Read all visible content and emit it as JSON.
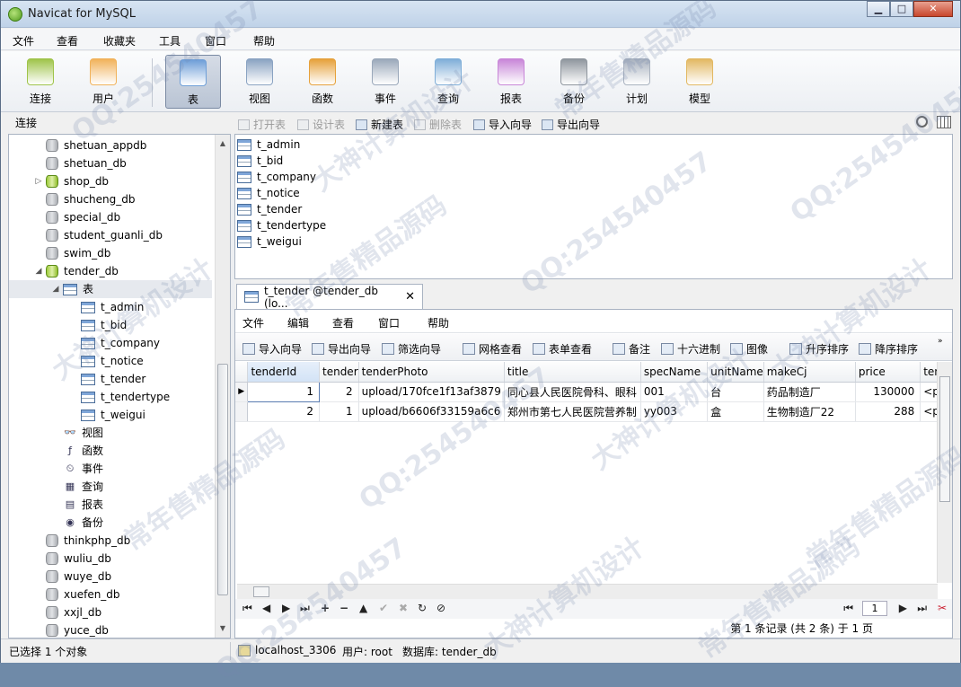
{
  "window": {
    "title": "Navicat for MySQL",
    "min_label": "▁",
    "max_label": "□",
    "close_label": "✕"
  },
  "menu": [
    "文件",
    "查看",
    "收藏夹",
    "工具",
    "窗口",
    "帮助"
  ],
  "toolbar": [
    {
      "label": "连接",
      "icon": "connection-icon",
      "color": "#9fc44a"
    },
    {
      "label": "用户",
      "icon": "user-icon",
      "color": "#f1b25a"
    },
    {
      "label": "表",
      "icon": "table-icon",
      "color": "#6f9fd8",
      "active": true
    },
    {
      "label": "视图",
      "icon": "view-icon",
      "color": "#8aa3c2"
    },
    {
      "label": "函数",
      "icon": "function-icon",
      "color": "#e6a13b"
    },
    {
      "label": "事件",
      "icon": "event-icon",
      "color": "#9aa8ba"
    },
    {
      "label": "查询",
      "icon": "query-icon",
      "color": "#7faed8"
    },
    {
      "label": "报表",
      "icon": "report-icon",
      "color": "#c886d8"
    },
    {
      "label": "备份",
      "icon": "backup-icon",
      "color": "#8f969e"
    },
    {
      "label": "计划",
      "icon": "schedule-icon",
      "color": "#a9b2bf"
    },
    {
      "label": "模型",
      "icon": "model-icon",
      "color": "#e2b862"
    }
  ],
  "connection_header": "连接",
  "object_toolbar": [
    {
      "label": "打开表",
      "disabled": true
    },
    {
      "label": "设计表",
      "disabled": true
    },
    {
      "label": "新建表",
      "disabled": false
    },
    {
      "label": "删除表",
      "disabled": true
    },
    {
      "label": "导入向导",
      "disabled": false
    },
    {
      "label": "导出向导",
      "disabled": false
    }
  ],
  "tree": {
    "databases_before": [
      "shetuan_appdb",
      "shetuan_db",
      "shop_db",
      "shucheng_db",
      "special_db",
      "student_guanli_db",
      "swim_db"
    ],
    "open_db": "tender_db",
    "tables_node": "表",
    "tables": [
      "t_admin",
      "t_bid",
      "t_company",
      "t_notice",
      "t_tender",
      "t_tendertype",
      "t_weigui"
    ],
    "objects": [
      {
        "label": "视图",
        "icon": "view-icon",
        "glyph": "👓"
      },
      {
        "label": "函数",
        "icon": "function-icon",
        "glyph": "ƒ"
      },
      {
        "label": "事件",
        "icon": "event-icon",
        "glyph": "⏲"
      },
      {
        "label": "查询",
        "icon": "query-icon",
        "glyph": "▦"
      },
      {
        "label": "报表",
        "icon": "report-icon",
        "glyph": "▤"
      },
      {
        "label": "备份",
        "icon": "backup-icon",
        "glyph": "◉"
      }
    ],
    "databases_after": [
      "thinkphp_db",
      "wuliu_db",
      "wuye_db",
      "xuefen_db",
      "xxjl_db",
      "yuce_db"
    ]
  },
  "object_list": [
    "t_admin",
    "t_bid",
    "t_company",
    "t_notice",
    "t_tender",
    "t_tendertype",
    "t_weigui"
  ],
  "tab": {
    "label": "t_tender @tender_db (lo...",
    "close": "✕"
  },
  "sub_menu": [
    "文件",
    "编辑",
    "查看",
    "窗口",
    "帮助"
  ],
  "data_toolbar": [
    "导入向导",
    "导出向导",
    "筛选向导",
    "网格查看",
    "表单查看",
    "备注",
    "十六进制",
    "图像",
    "升序排序",
    "降序排序"
  ],
  "grid": {
    "columns": [
      "tenderId",
      "tender",
      "tenderPhoto",
      "title",
      "specName",
      "unitName",
      "makeCj",
      "price",
      "tenc"
    ],
    "rows": [
      [
        "1",
        "2",
        "upload/170fce1f13af3879",
        "同心县人民医院骨科、眼科",
        "001",
        "台",
        "药品制造厂",
        "130000",
        "<p>"
      ],
      [
        "2",
        "1",
        "upload/b6606f33159a6c6",
        "郑州市第七人民医院营养制",
        "yy003",
        "盒",
        "生物制造厂22",
        "288",
        "<p>"
      ]
    ]
  },
  "navigation": {
    "page": "1",
    "record_summary": "第 1 条记录 (共 2 条) 于 1 页"
  },
  "status": {
    "selection": "已选择 1 个对象",
    "connection": "localhost_3306",
    "user": "用户: root",
    "database": "数据库: tender_db"
  },
  "watermarks": [
    "QQ:254540457",
    "大神计算机设计",
    "常年售精品源码"
  ]
}
